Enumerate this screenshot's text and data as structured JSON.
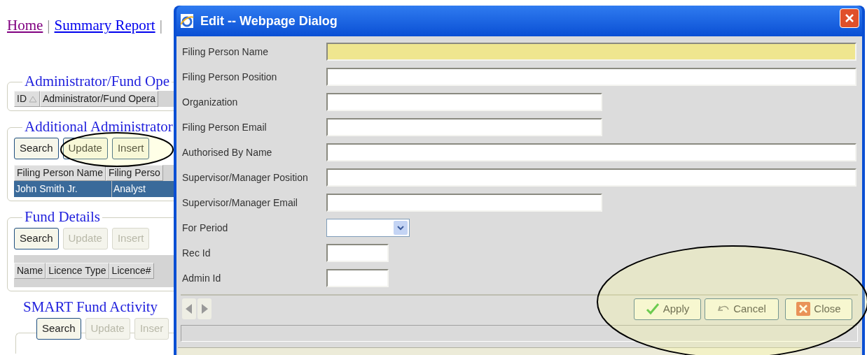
{
  "nav": [
    {
      "kind": "link",
      "label": "Home",
      "visited": true
    },
    {
      "kind": "separator",
      "label": "|"
    },
    {
      "kind": "link",
      "label": "Summary Report",
      "visited": false
    },
    {
      "kind": "separator",
      "label": "|"
    }
  ],
  "sections": [
    {
      "legend": "Administrator/Fund Ope",
      "kind": "boxed",
      "columns": [
        {
          "label": "ID",
          "sorted": true
        },
        {
          "label": "Administrator/Fund Opera",
          "sorted": false
        }
      ]
    },
    {
      "legend": "Additional Administrator",
      "kind": "boxed",
      "buttons": [
        {
          "label": "Search",
          "disabled": false
        },
        {
          "label": "Update",
          "disabled": false
        },
        {
          "label": "Insert",
          "disabled": false
        }
      ],
      "columns": [
        {
          "label": "Filing Person Name",
          "sorted": false
        },
        {
          "label": "Filing Perso",
          "sorted": false
        }
      ],
      "rows": [
        {
          "cells": [
            "John Smith Jr.",
            "Analyst"
          ],
          "selected": true
        }
      ]
    },
    {
      "legend": "Fund Details",
      "kind": "boxed",
      "buttons": [
        {
          "label": "Search",
          "disabled": false
        },
        {
          "label": "Update",
          "disabled": true
        },
        {
          "label": "Insert",
          "disabled": true
        }
      ],
      "columns": [
        {
          "label": "Name",
          "sorted": false
        },
        {
          "label": "Licence Type",
          "sorted": false
        },
        {
          "label": "Licence#",
          "sorted": false
        }
      ]
    },
    {
      "legend": "SMART Fund Activity",
      "kind": "open",
      "buttons": [
        {
          "label": "Search",
          "disabled": false
        },
        {
          "label": "Update",
          "disabled": true
        },
        {
          "label": "Inser",
          "disabled": true
        }
      ]
    }
  ],
  "dialog": {
    "title": "Edit -- Webpage Dialog",
    "fields": [
      {
        "label": "Filing Person Name",
        "kind": "wide",
        "focused": true
      },
      {
        "label": "Filing Person Position",
        "kind": "wide",
        "focused": false
      },
      {
        "label": "Organization",
        "kind": "medium",
        "focused": false
      },
      {
        "label": "Filing Person Email",
        "kind": "medium",
        "focused": false
      },
      {
        "label": "Authorised By Name",
        "kind": "wide",
        "focused": false
      },
      {
        "label": "Supervisor/Manager Position",
        "kind": "wide",
        "focused": false
      },
      {
        "label": "Supervisor/Manager Email",
        "kind": "medium",
        "focused": false
      },
      {
        "label": "For Period",
        "kind": "select",
        "focused": false
      },
      {
        "label": "Rec Id",
        "kind": "short",
        "focused": false
      },
      {
        "label": "Admin Id",
        "kind": "short",
        "focused": false
      }
    ],
    "actions": [
      {
        "label": "Apply",
        "kind": "check"
      },
      {
        "label": "Cancel",
        "kind": "undo"
      },
      {
        "label": "Close",
        "kind": "close"
      }
    ]
  }
}
